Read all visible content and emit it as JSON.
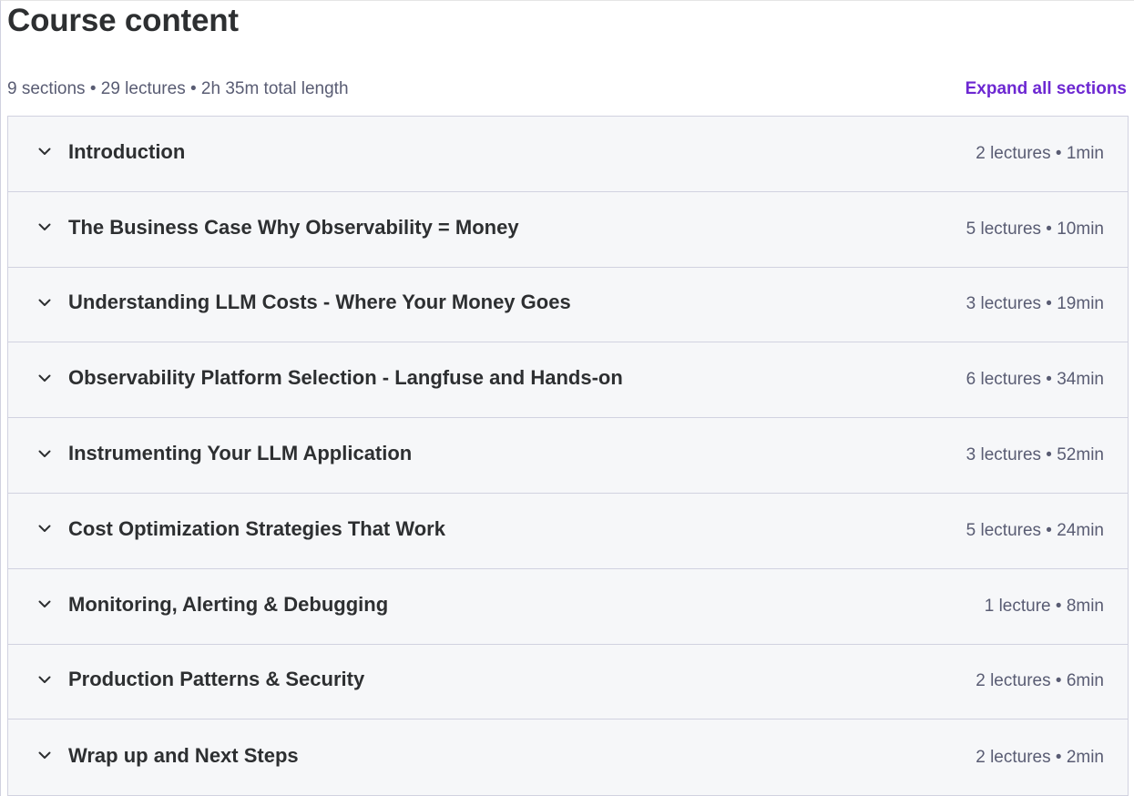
{
  "header": {
    "title": "Course content",
    "summary": "9 sections • 29 lectures • 2h 35m total length",
    "expand_all_label": "Expand all sections"
  },
  "colors": {
    "accent": "#6d28d2",
    "section_bg": "#f6f7f9",
    "text": "#2d2f31",
    "muted": "#595c73",
    "border": "#d1d2e0"
  },
  "sections": [
    {
      "title": "Introduction",
      "meta": "2 lectures • 1min",
      "icon": "chevron-down-icon"
    },
    {
      "title": "The Business Case Why Observability = Money",
      "meta": "5 lectures • 10min",
      "icon": "chevron-down-icon"
    },
    {
      "title": "Understanding LLM Costs - Where Your Money Goes",
      "meta": "3 lectures • 19min",
      "icon": "chevron-down-icon"
    },
    {
      "title": "Observability Platform Selection - Langfuse and Hands-on",
      "meta": "6 lectures • 34min",
      "icon": "chevron-down-icon"
    },
    {
      "title": "Instrumenting Your LLM Application",
      "meta": "3 lectures • 52min",
      "icon": "chevron-down-icon"
    },
    {
      "title": "Cost Optimization Strategies That Work",
      "meta": "5 lectures • 24min",
      "icon": "chevron-down-icon"
    },
    {
      "title": "Monitoring, Alerting & Debugging",
      "meta": "1 lecture • 8min",
      "icon": "chevron-down-icon"
    },
    {
      "title": "Production Patterns & Security",
      "meta": "2 lectures • 6min",
      "icon": "chevron-down-icon"
    },
    {
      "title": "Wrap up and Next Steps",
      "meta": "2 lectures • 2min",
      "icon": "chevron-down-icon"
    }
  ]
}
